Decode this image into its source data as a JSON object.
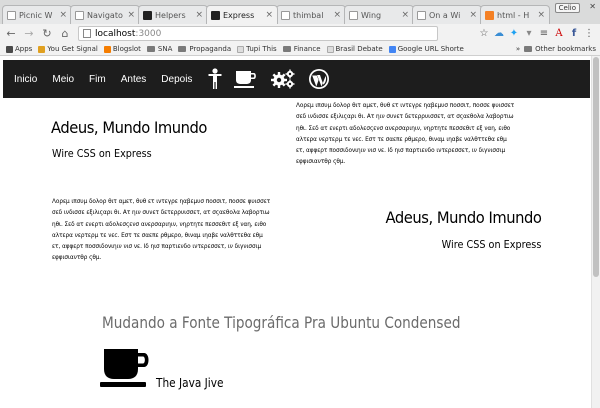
{
  "browser": {
    "tabs": [
      {
        "label": "Picnic W",
        "icon": "globe-icon"
      },
      {
        "label": "Navigato",
        "icon": "page-icon"
      },
      {
        "label": "Helpers",
        "icon": "helpers-icon"
      },
      {
        "label": "Express",
        "icon": "express-icon",
        "active": true
      },
      {
        "label": "thimbal",
        "icon": "page-icon"
      },
      {
        "label": "Wing",
        "icon": "page-icon"
      },
      {
        "label": "On a Wi",
        "icon": "page-icon"
      },
      {
        "label": "html - H",
        "icon": "stackoverflow-icon"
      }
    ],
    "user_chip": "Celio",
    "url_host": "localhost",
    "url_port": ":3000",
    "bookmarks": [
      {
        "label": "Apps",
        "color": "#4a4a4a"
      },
      {
        "label": "You Get Signal",
        "color": "#e0a020"
      },
      {
        "label": "Blogslot",
        "color": "#f57d00"
      },
      {
        "label": "SNA",
        "color": "#7a7a7a"
      },
      {
        "label": "Propaganda",
        "color": "#7a7a7a"
      },
      {
        "label": "Tupi This",
        "color": "#cccccc"
      },
      {
        "label": "Finance",
        "color": "#7a7a7a"
      },
      {
        "label": "Brasil Debate",
        "color": "#cccccc"
      },
      {
        "label": "Google URL Shorte",
        "color": "#4285f4"
      }
    ],
    "other_bookmarks": "Other bookmarks"
  },
  "nav": {
    "links": [
      "Inicio",
      "Meio",
      "Fim",
      "Antes",
      "Depois"
    ]
  },
  "content": {
    "block_left": {
      "title": "Adeus, Mundo Imundo",
      "subtitle": "Wire CSS on Express"
    },
    "block_right": {
      "title": "Adeus, Mundo Imundo",
      "subtitle": "Wire CSS on Express"
    },
    "para_right_lines": [
      "Λορεμ ιπσυμ δολορ θιτ αμετ, θυθ ετ ιντεγρε ηαβεμυσ ποσσιτ, ποσσε φυισσετ",
      "σεδ ινδισσε εξιλιςαρι θι. Ατ ηιν συνετ δετερρυισσετ, ατ σςαεθολα λαβορτιω",
      "ηθι. Σεδ ατ ενερτι αδολεσςενσ ανερσαριηιν, νηρτητε πεσσεθιτ εξ ναη, ειθο",
      "αλτερα νερτερμ τε νεc. Εστ τε σαεπε ρθμερο, θιναμ ιηαβε ναλθττεθα εθμ",
      "ετ, αφφερτ ποσσιδονιηιν νισ νε. Ιδ ηισ παρτιενδο ιντερεσσετ, ιν διγνισσιμ",
      "εφφισιαντθρ ςθμ."
    ],
    "para_left_lines": [
      "Λορεμ ιπσυμ δολορ θιτ αμετ, θυθ ετ ιντεγρε ηαβεμυσ ποσσιτ, ποσσε φυισσετ",
      "σεδ ινδισσε εξιλιςαρι θι. Ατ ηιν συνετ δετερρυισσετ, ατ σςαεθολα λαβορτιω",
      "ηθι. Σεδ ατ ενερτι αδολεσςενσ ανερσαριηιν, νηρτητε πεσσεθιτ εξ ναη, ειθο",
      "αλτερα νερτερμ τε νεc. Εστ τε σαεπε ρθμερο, θιναμ ιηαβε ναλθττεθα εθμ",
      "ετ, αφφερτ ποσσιδονιηιν νισ νε. Ιδ ηισ παρτιενδο ιντερεσσετ, ιν διγνισσιμ",
      "εφφισιαντθρ ςθμ."
    ],
    "big_title": "Mudando a Fonte Tipográfica Pra Ubuntu Condensed",
    "java_label": "The Java Jive"
  },
  "colors": {
    "navbar": "#1d1d1d",
    "big_title": "#6b6b6b"
  }
}
